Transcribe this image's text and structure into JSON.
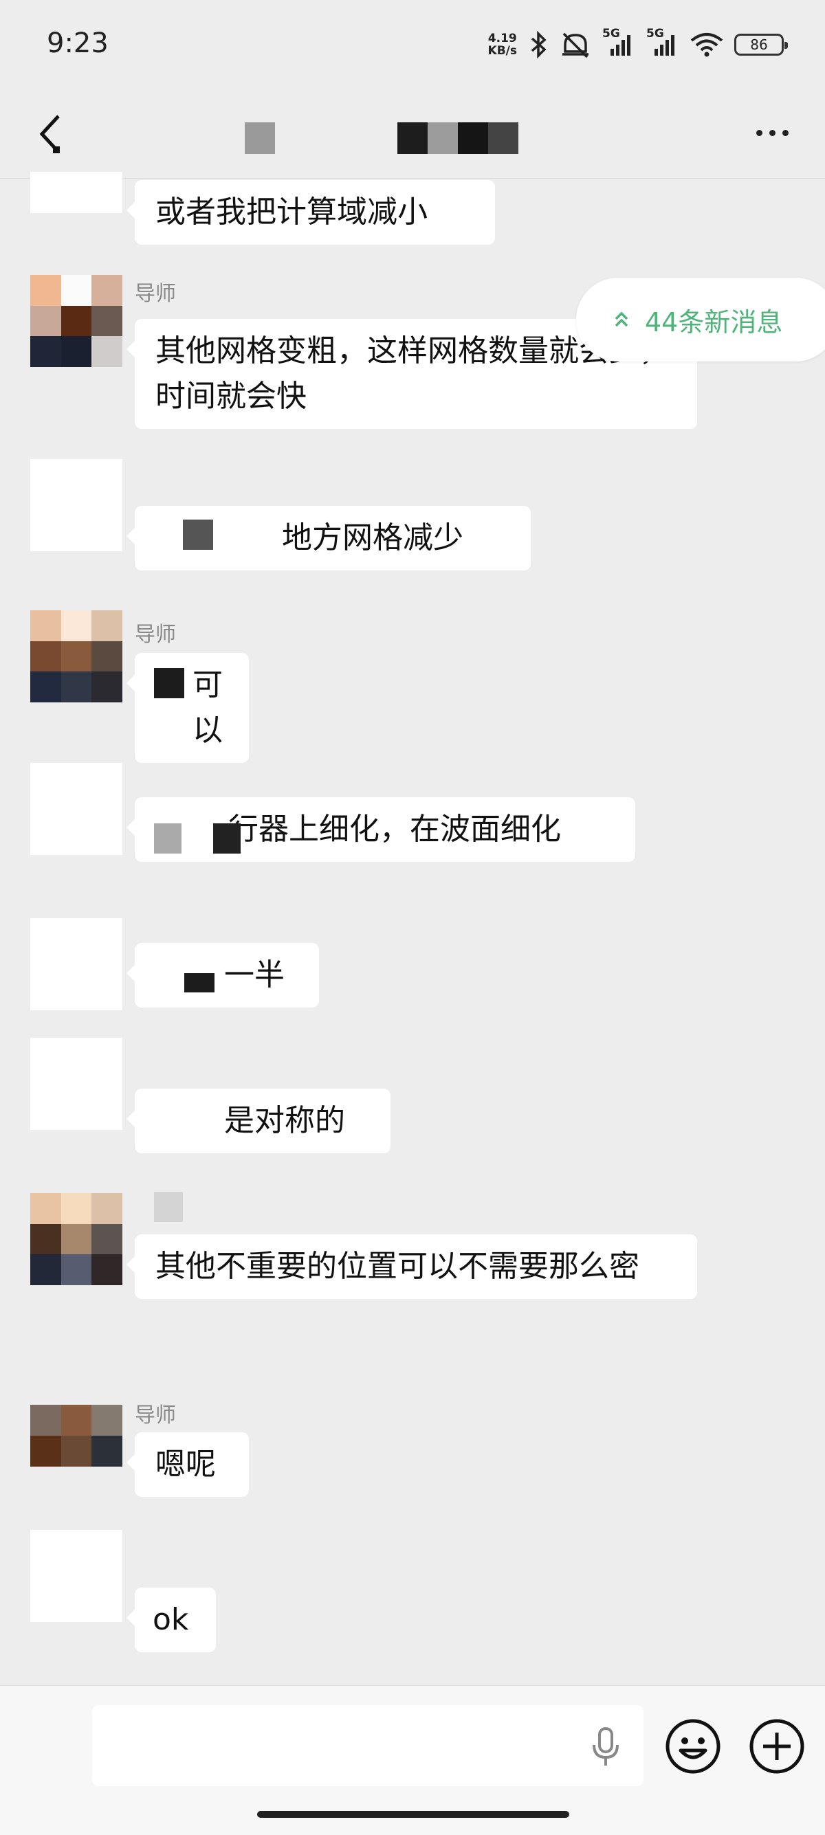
{
  "status_bar": {
    "time": "9:23",
    "net_speed_value": "4.19",
    "net_speed_unit": "KB/s",
    "signal_1_label": "5G",
    "signal_2_label": "5G",
    "battery_level": "86"
  },
  "header": {
    "title": "",
    "more_icon": "more-dots-icon",
    "back_icon": "back-arrow-icon"
  },
  "new_messages": {
    "label": "44条新消息",
    "icon": "double-chevron-up-icon"
  },
  "messages": [
    {
      "sender": "",
      "text": "或者我把计算域减小"
    },
    {
      "sender": "导师",
      "text": "其他网格变粗，这样网格数量就会少，时间就会快"
    },
    {
      "sender": "",
      "text": "地方网格减少"
    },
    {
      "sender": "导师",
      "text": "可以"
    },
    {
      "sender": "",
      "text": "行器上细化，在波面细化"
    },
    {
      "sender": "",
      "text": "一半"
    },
    {
      "sender": "",
      "text": "是对称的"
    },
    {
      "sender": "",
      "text": "其他不重要的位置可以不需要那么密"
    },
    {
      "sender": "导师",
      "text": "嗯呢"
    },
    {
      "sender": "",
      "text": "ok"
    }
  ],
  "input_bar": {
    "placeholder": "",
    "mic_icon": "microphone-icon",
    "emoji_icon": "emoji-icon",
    "plus_icon": "plus-icon"
  },
  "colors": {
    "background": "#ededed",
    "bubble": "#ffffff",
    "accent_green": "#4fb47a"
  }
}
